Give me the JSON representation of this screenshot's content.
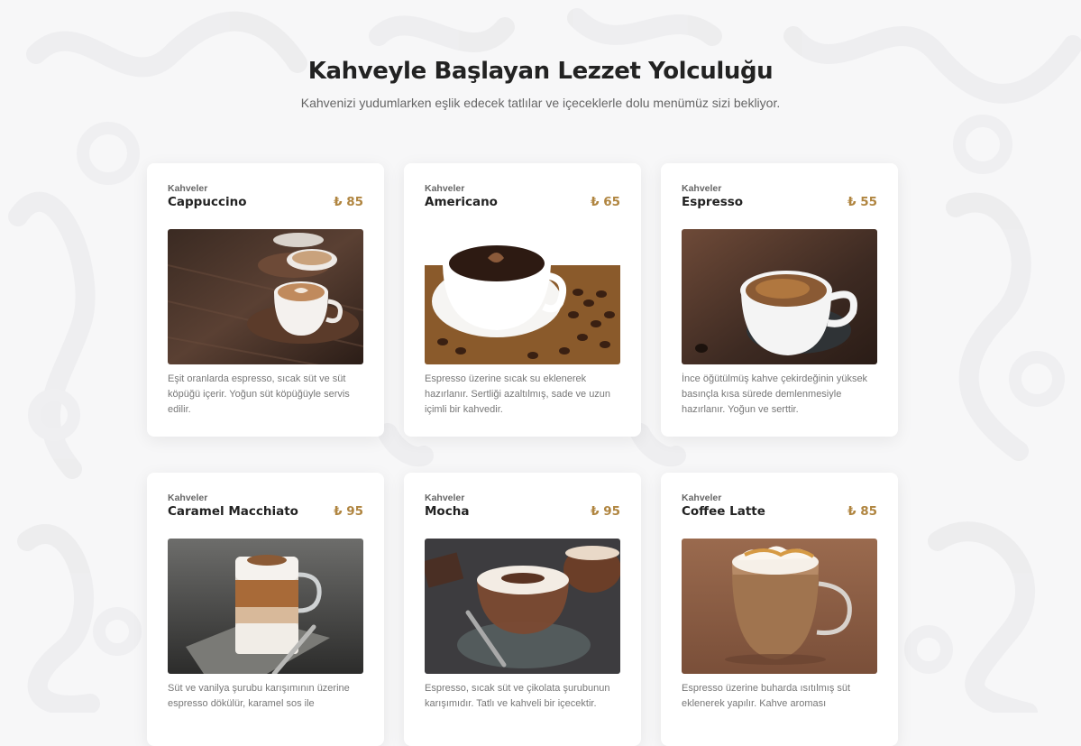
{
  "header": {
    "title": "Kahveyle Başlayan Lezzet Yolculuğu",
    "subtitle": "Kahvenizi yudumlarken eşlik edecek tatlılar ve içeceklerle dolu menümüz sizi bekliyor."
  },
  "colors": {
    "price": "#b08540",
    "background": "#f7f7f8",
    "card": "#ffffff"
  },
  "products": [
    {
      "category": "Kahveler",
      "name": "Cappuccino",
      "price": "₺ 85",
      "image": "cappuccino-image",
      "description": "Eşit oranlarda espresso, sıcak süt ve süt köpüğü içerir. Yoğun süt köpüğüyle servis edilir."
    },
    {
      "category": "Kahveler",
      "name": "Americano",
      "price": "₺ 65",
      "image": "americano-image",
      "description": "Espresso üzerine sıcak su eklenerek hazırlanır. Sertliği azaltılmış, sade ve uzun içimli bir kahvedir."
    },
    {
      "category": "Kahveler",
      "name": "Espresso",
      "price": "₺ 55",
      "image": "espresso-image",
      "description": "İnce öğütülmüş kahve çekirdeğinin yüksek basınçla kısa sürede demlenmesiyle hazırlanır. Yoğun ve serttir."
    },
    {
      "category": "Kahveler",
      "name": "Caramel Macchiato",
      "price": "₺ 95",
      "image": "caramel-macchiato-image",
      "description": "Süt ve vanilya şurubu karışımının üzerine espresso dökülür, karamel sos ile"
    },
    {
      "category": "Kahveler",
      "name": "Mocha",
      "price": "₺ 95",
      "image": "mocha-image",
      "description": "Espresso, sıcak süt ve çikolata şurubunun karışımıdır. Tatlı ve kahveli bir içecektir."
    },
    {
      "category": "Kahveler",
      "name": "Coffee Latte",
      "price": "₺ 85",
      "image": "coffee-latte-image",
      "description": "Espresso üzerine buharda ısıtılmış süt eklenerek yapılır. Kahve aroması"
    }
  ]
}
